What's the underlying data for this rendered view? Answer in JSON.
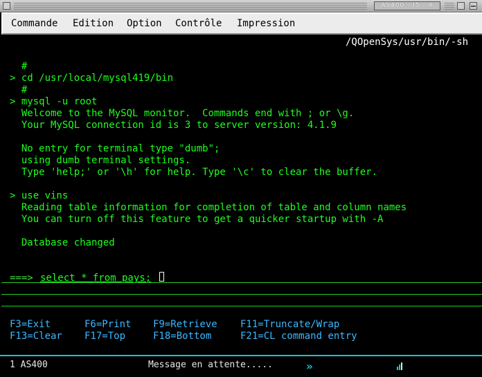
{
  "window": {
    "title": "AS400 - I5 - A"
  },
  "menu": {
    "items": [
      "Commande",
      "Edition",
      "Option",
      "Contrôle",
      "Impression"
    ]
  },
  "terminal": {
    "path": "/QOpenSys/usr/bin/-sh",
    "lines": [
      "  #",
      "> cd /usr/local/mysql419/bin",
      "  #",
      "> mysql -u root",
      "  Welcome to the MySQL monitor.  Commands end with ; or \\g.",
      "  Your MySQL connection id is 3 to server version: 4.1.9",
      "",
      "  No entry for terminal type \"dumb\";",
      "  using dumb terminal settings.",
      "  Type 'help;' or '\\h' for help. Type '\\c' to clear the buffer.",
      "",
      "> use vins",
      "  Reading table information for completion of table and column names",
      "  You can turn off this feature to get a quicker startup with -A",
      "",
      "  Database changed"
    ],
    "prompt": "===>",
    "input_value": "select * from pays;"
  },
  "function_keys": [
    {
      "label": "F3=Exit"
    },
    {
      "label": "F6=Print"
    },
    {
      "label": "F9=Retrieve"
    },
    {
      "label": "F11=Truncate/Wrap"
    },
    {
      "label": "F13=Clear"
    },
    {
      "label": "F17=Top"
    },
    {
      "label": "F18=Bottom"
    },
    {
      "label": "F21=CL command entry"
    }
  ],
  "status": {
    "session": "1 AS400",
    "message": "Message en attente.....",
    "arrows_icon": "double-chevron-right",
    "signal_icon": "signal-bars"
  },
  "colors": {
    "terminal_bg": "#000000",
    "terminal_text": "#1eff1e",
    "function_keys": "#3cb8ff",
    "status_border": "#18c8d8"
  }
}
